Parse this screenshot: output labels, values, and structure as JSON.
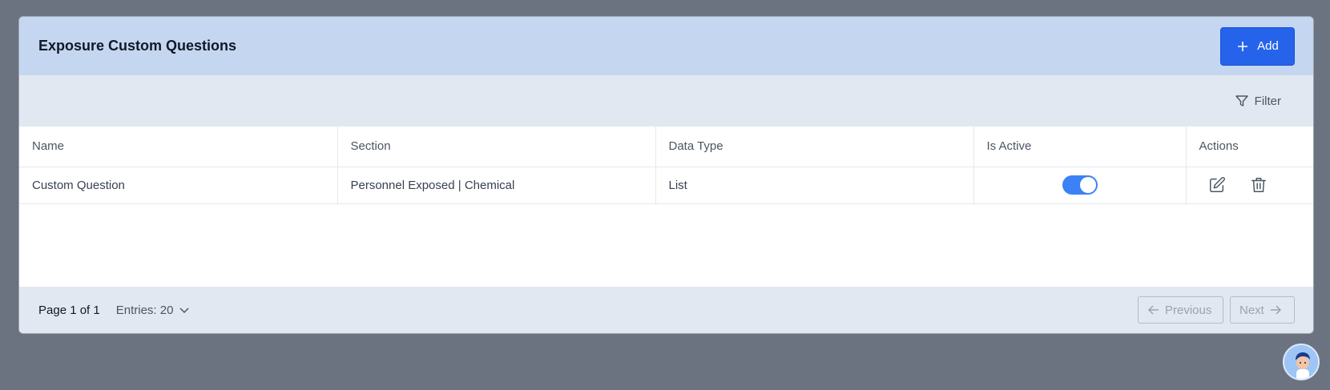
{
  "header": {
    "title": "Exposure Custom Questions",
    "add_label": "Add"
  },
  "toolbar": {
    "filter_label": "Filter"
  },
  "table": {
    "columns": [
      "Name",
      "Section",
      "Data Type",
      "Is Active",
      "Actions"
    ],
    "rows": [
      {
        "name": "Custom Question",
        "section": "Personnel Exposed | Chemical",
        "data_type": "List",
        "is_active": true
      }
    ]
  },
  "footer": {
    "page_info": "Page 1 of 1",
    "entries_label": "Entries: 20",
    "previous_label": "Previous",
    "next_label": "Next"
  },
  "colors": {
    "accent": "#2563eb",
    "header_bg": "#c5d7f0",
    "toolbar_bg": "#e1e8f1",
    "toggle_on": "#3b82f6"
  },
  "icons": [
    "plus-icon",
    "filter-icon",
    "edit-icon",
    "trash-icon",
    "chevron-down-icon",
    "arrow-left-icon",
    "arrow-right-icon"
  ]
}
